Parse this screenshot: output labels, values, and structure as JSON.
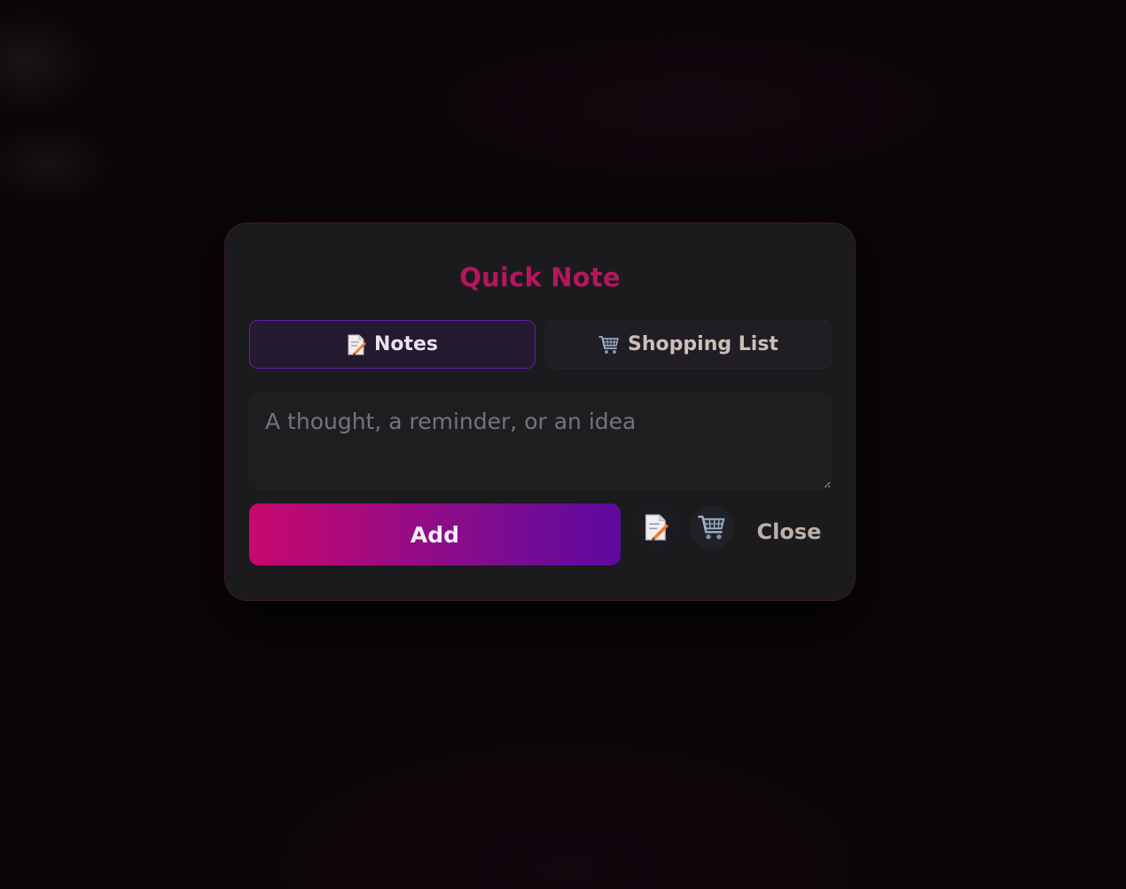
{
  "modal": {
    "title": "Quick Note",
    "accent_color": "#b5165e"
  },
  "tabs": [
    {
      "label": "Notes",
      "icon": "memo-icon",
      "active": true
    },
    {
      "label": "Shopping List",
      "icon": "shopping-cart-icon",
      "active": false
    }
  ],
  "note_input": {
    "placeholder": "A thought, a reminder, or an idea",
    "value": ""
  },
  "actions": {
    "add_label": "Add",
    "add_gradient": [
      "#c8086e",
      "#5c0aa0"
    ],
    "quick_note_icon": "memo-icon",
    "quick_shopping_icon": "shopping-cart-icon",
    "close_label": "Close"
  }
}
